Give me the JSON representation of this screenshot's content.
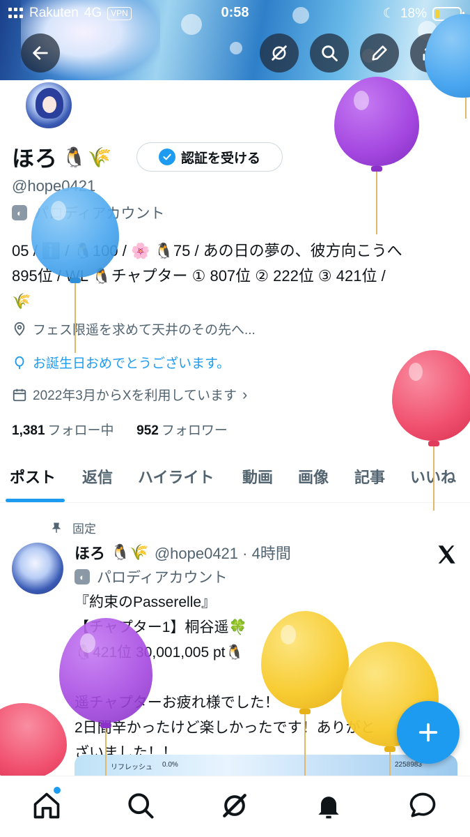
{
  "status_bar": {
    "carrier": "Rakuten",
    "network": "4G",
    "vpn": "VPN",
    "time": "0:58",
    "battery": "18%"
  },
  "profile": {
    "name": "ほろ",
    "verify_button": "認証を受ける",
    "handle": "@hope0421",
    "parody_label": "パロディアカウント",
    "bio_lines": [
      "05 / ℹ️ / 🐧100 / 🌸 🐧75 / あの日の夢の、彼方向こうへ",
      "895位 / WL 🐧チャプター ① 807位 ② 222位 ③ 421位 /",
      "🌾"
    ],
    "location": "フェス限遥を求めて天井のその先へ...",
    "birthday": "お誕生日おめでとうございます。",
    "joined": "2022年3月からXを利用しています",
    "following_count": "1,381",
    "following_label": "フォロー中",
    "followers_count": "952",
    "followers_label": "フォロワー"
  },
  "tabs": [
    "ポスト",
    "返信",
    "ハイライト",
    "動画",
    "画像",
    "記事",
    "いいね"
  ],
  "active_tab": "ポスト",
  "post": {
    "pinned_label": "固定",
    "author": "ほろ",
    "handle_time": "@hope0421 · 4時間",
    "parody_label": "パロディアカウント",
    "lines": [
      "『約束のPasserelle』",
      "【チャプター1】桐谷遥🍀",
      "🐧421位 30,001,005 pt🐧",
      "",
      "遥チャプターお疲れ様でした！",
      "2日間辛かったけど楽しかったです！ありがと",
      "ざいました！！"
    ],
    "media": {
      "refresh_label": "リフレッシュ",
      "percent": "0.0%",
      "score": "2258983"
    }
  },
  "colors": {
    "accent": "#1d9bf0",
    "text": "#0f1419",
    "muted": "#536471",
    "balloon_purple": "#a447e0",
    "balloon_blue": "#49a6ef",
    "balloon_pink": "#f0506e",
    "balloon_yellow": "#f7c928"
  },
  "icons": {
    "back": "arrow-left-icon",
    "grok": "grok-icon",
    "search": "search-icon",
    "edit": "pencil-icon",
    "share": "share-icon",
    "home": "home-icon",
    "notifications": "bell-icon",
    "messages": "chat-icon",
    "compose": "plus-icon"
  }
}
